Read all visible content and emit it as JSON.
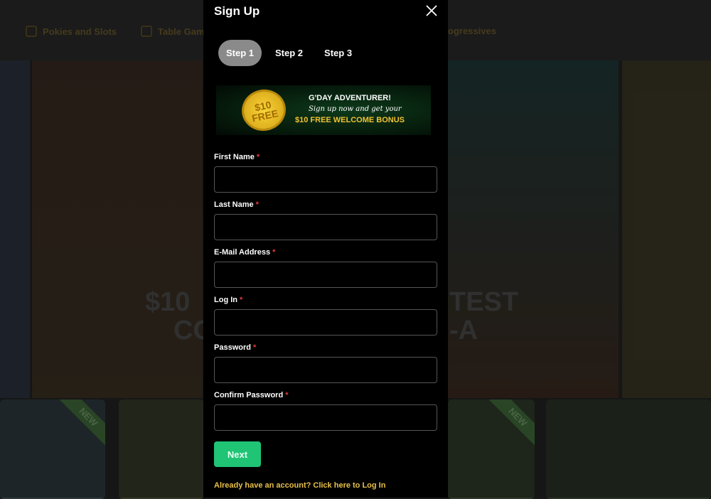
{
  "background": {
    "nav": [
      "Pokies and Slots",
      "Table Gam",
      "ogressives"
    ],
    "hero_left": [
      "$10",
      "CO"
    ],
    "hero_right": [
      "TEST",
      "-A"
    ],
    "badge": "NEW"
  },
  "modal": {
    "title": "Sign Up",
    "steps": [
      "Step 1",
      "Step 2",
      "Step 3"
    ],
    "banner": {
      "coin": "$10 FREE",
      "line1": "G'DAY ADVENTURER!",
      "line2": "Sign up now and get your",
      "line3": "$10 FREE WELCOME BONUS"
    },
    "fields": [
      {
        "label": "First Name",
        "required": "*",
        "value": ""
      },
      {
        "label": "Last Name",
        "required": "*",
        "value": ""
      },
      {
        "label": "E-Mail Address",
        "required": "*",
        "value": ""
      },
      {
        "label": "Log In",
        "required": "*",
        "value": ""
      },
      {
        "label": "Password",
        "required": "*",
        "value": ""
      },
      {
        "label": "Confirm Password",
        "required": "*",
        "value": ""
      }
    ],
    "next_label": "Next",
    "login_link": "Already have an account? Click here to Log In",
    "colors": {
      "accent": "#1fc475",
      "link": "#e8c04a",
      "required": "#e23b3b"
    }
  }
}
